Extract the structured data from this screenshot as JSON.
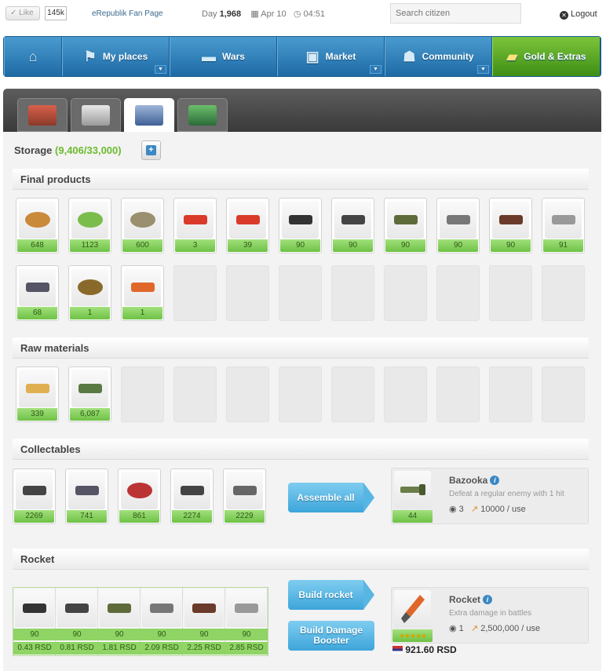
{
  "topbar": {
    "like_label": "Like",
    "like_count": "145k",
    "fan_page": "eRepublik Fan Page",
    "day_label": "Day",
    "day_value": "1,968",
    "date": "Apr 10",
    "time": "04:51",
    "search_placeholder": "Search citizen",
    "logout": "Logout"
  },
  "nav": {
    "items": [
      {
        "label": "My places",
        "icon": "flag-icon"
      },
      {
        "label": "Wars",
        "icon": "tank-icon"
      },
      {
        "label": "Market",
        "icon": "bag-icon"
      },
      {
        "label": "Community",
        "icon": "people-icon"
      },
      {
        "label": "Gold & Extras",
        "icon": "gold-bars-icon"
      }
    ]
  },
  "storage": {
    "label": "Storage",
    "capacity": "(9,406/33,000)"
  },
  "sections": {
    "final_products": "Final products",
    "raw_materials": "Raw materials",
    "collectables": "Collectables",
    "rocket": "Rocket"
  },
  "final_products": [
    "648",
    "1123",
    "600",
    "3",
    "39",
    "90",
    "90",
    "90",
    "90",
    "90",
    "91",
    "68",
    "1",
    "1"
  ],
  "raw_materials": [
    "339",
    "6,087"
  ],
  "collectables": [
    "2269",
    "741",
    "861",
    "2274",
    "2229"
  ],
  "assemble": {
    "button": "Assemble all",
    "item_name": "Bazooka",
    "item_desc": "Defeat a regular enemy with 1 hit",
    "item_count": "44",
    "uses": "3",
    "damage": "10000 / use"
  },
  "rocket": {
    "counts": [
      "90",
      "90",
      "90",
      "90",
      "90",
      "90"
    ],
    "prices": [
      "0.43 RSD",
      "0.81 RSD",
      "1.81 RSD",
      "2.09 RSD",
      "2.25 RSD",
      "2.85 RSD"
    ],
    "build_button": "Build rocket",
    "booster_button": "Build Damage Booster",
    "name": "Rocket",
    "desc": "Extra damage in battles",
    "uses": "1",
    "damage": "2,500,000 / use",
    "total_price": "921.60 RSD",
    "stars": "★★★★★"
  },
  "colors": {
    "nav_blue": "#2a7cbb",
    "gold_green": "#5aab24",
    "count_green": "#8fd465",
    "button_blue": "#4cb0e0",
    "storage_green": "#6cbb2e"
  }
}
